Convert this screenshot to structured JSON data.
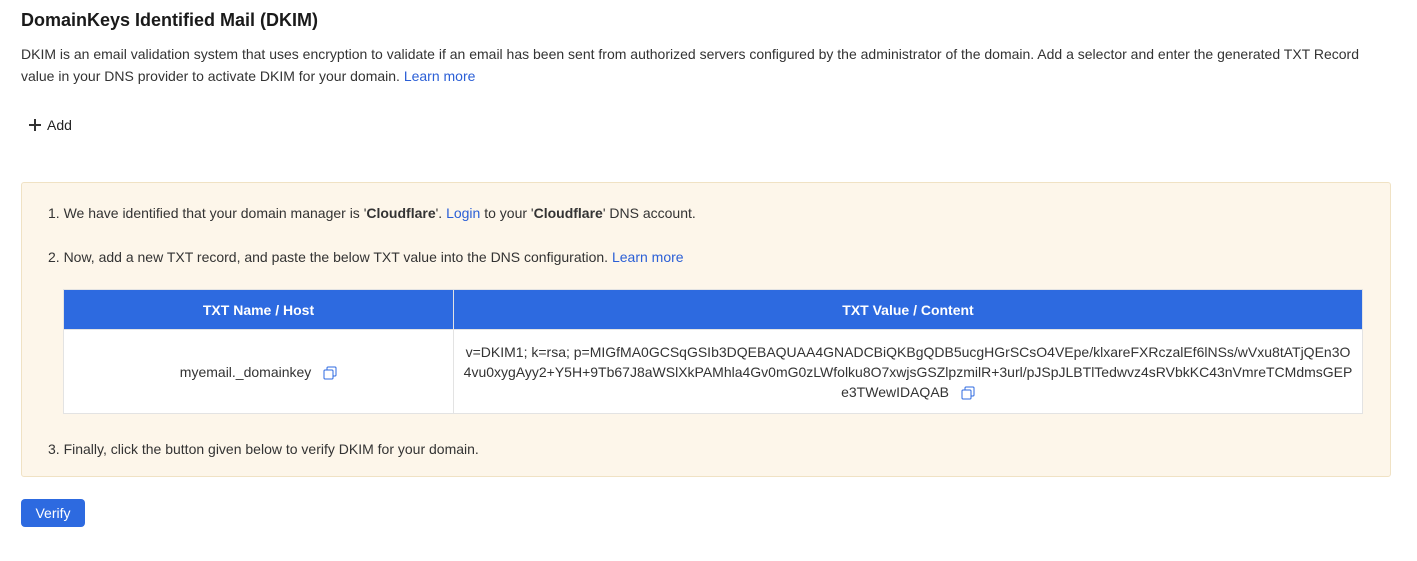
{
  "header": {
    "title": "DomainKeys Identified Mail (DKIM)",
    "description": "DKIM is an email validation system that uses encryption to validate if an email has been sent from authorized servers configured by the administrator of the domain. Add a selector and enter the generated TXT Record value in your DNS provider to activate DKIM for your domain.",
    "learn_more": "Learn more"
  },
  "add_label": "Add",
  "steps": {
    "step1": {
      "prefix": "1. We have identified that your domain manager is '",
      "manager": "Cloudflare",
      "mid": "'. ",
      "login": "Login",
      "mid2": " to your '",
      "manager2": "Cloudflare",
      "suffix": "' DNS account."
    },
    "step2": {
      "text": "2. Now, add a new TXT record, and paste the below TXT value into the DNS configuration.",
      "learn_more": "Learn more"
    },
    "step3": {
      "text": "3. Finally, click the button given below to verify DKIM for your domain."
    }
  },
  "table": {
    "headers": [
      "TXT Name / Host",
      "TXT Value / Content"
    ],
    "row": {
      "name": "myemail._domainkey",
      "value": "v=DKIM1; k=rsa; p=MIGfMA0GCSqGSIb3DQEBAQUAA4GNADCBiQKBgQDB5ucgHGrSCsO4VEpe/klxareFXRczalEf6lNSs/wVxu8tATjQEn3O4vu0xygAyy2+Y5H+9Tb67J8aWSlXkPAMhla4Gv0mG0zLWfolku8O7xwjsGSZlpzmilR+3url/pJSpJLBTlTedwvz4sRVbkKC43nVmreTCMdmsGEPe3TWewIDAQAB"
    }
  },
  "verify_label": "Verify",
  "colors": {
    "accent": "#2d6ae0",
    "link": "#2b5fd6",
    "panel_bg": "#fdf6ea"
  }
}
